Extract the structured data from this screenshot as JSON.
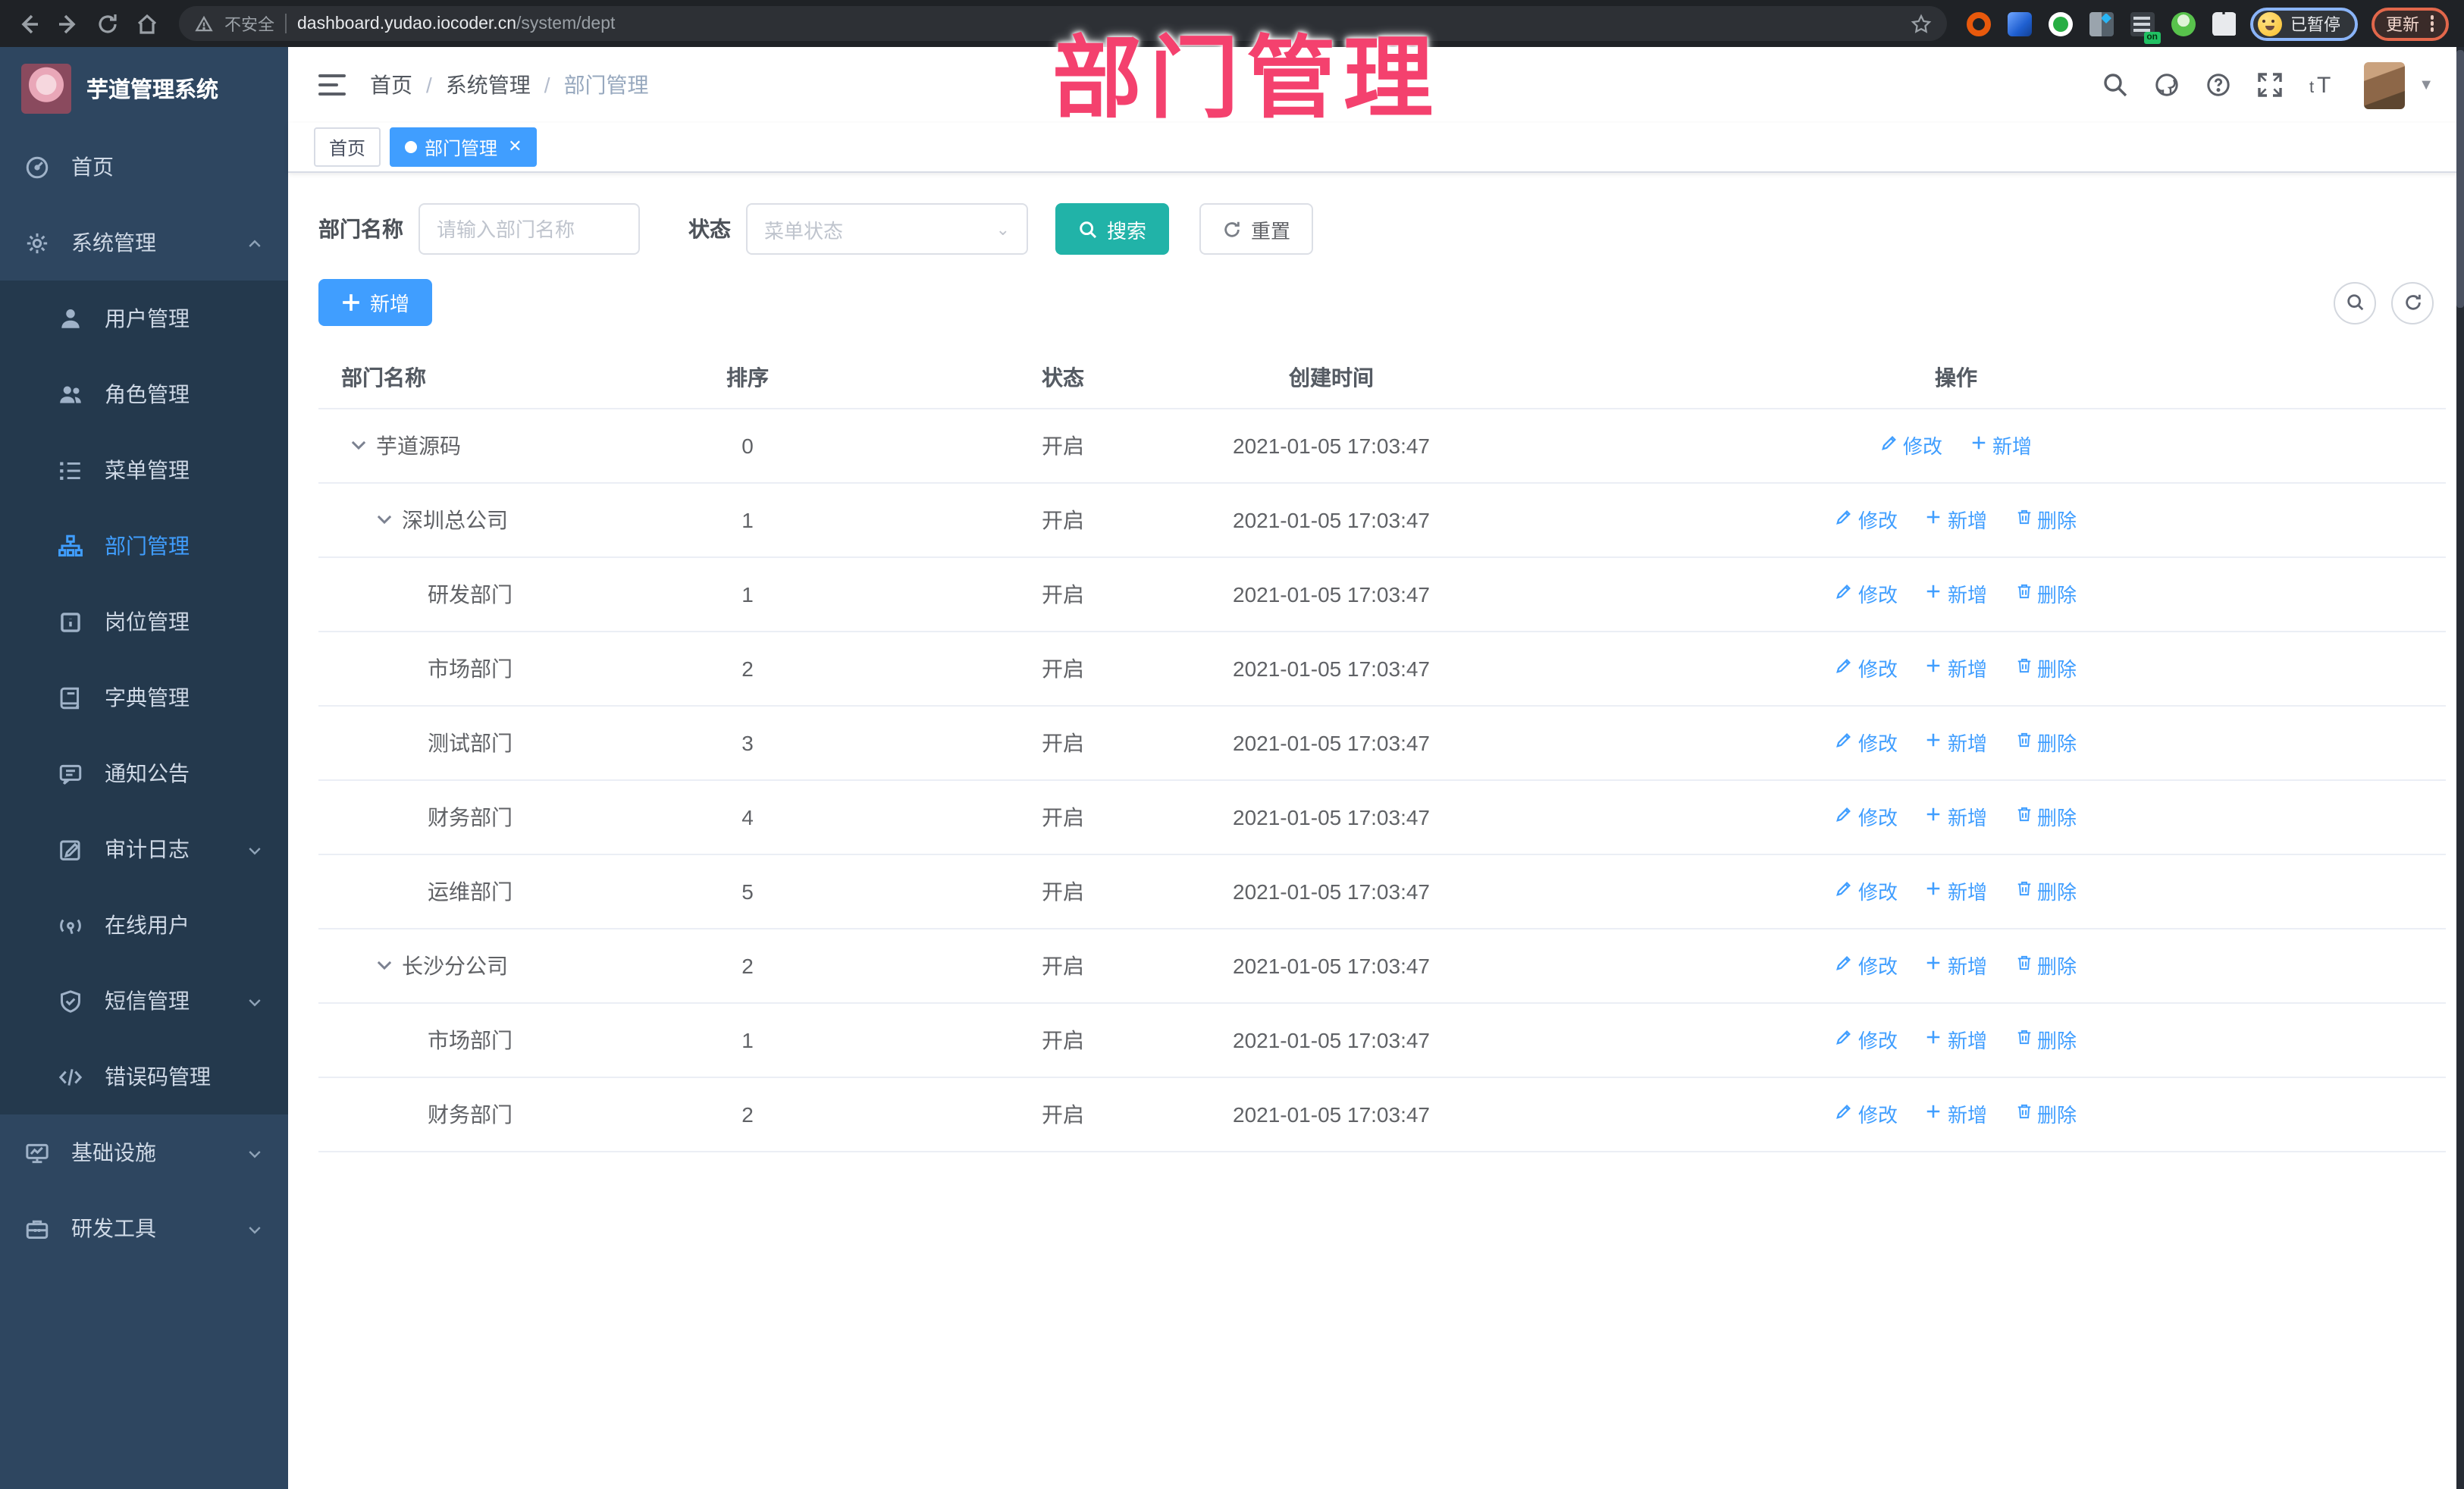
{
  "theme": {
    "accent_blue": "#409EFF",
    "search_teal": "#21b3a8",
    "overlay_pink": "#f4416e",
    "sidebar_bg": "#2e4660",
    "submenu_bg": "#24394d",
    "browser_bg": "#1f2226"
  },
  "browser": {
    "security_label": "不安全",
    "url_host": "dashboard.yudao.iocoder.cn",
    "url_path": "/system/dept",
    "profile_status": "已暂停",
    "update_label": "更新",
    "extension_on_badge": "on"
  },
  "sidebar": {
    "app_title": "芋道管理系统",
    "items": [
      {
        "label": "首页",
        "icon": "dashboard-icon",
        "type": "top"
      },
      {
        "label": "系统管理",
        "icon": "gear-icon",
        "type": "top",
        "arrow": "up"
      },
      {
        "label": "用户管理",
        "icon": "user-icon",
        "type": "sub"
      },
      {
        "label": "角色管理",
        "icon": "users-icon",
        "type": "sub"
      },
      {
        "label": "菜单管理",
        "icon": "menu-list-icon",
        "type": "sub"
      },
      {
        "label": "部门管理",
        "icon": "org-tree-icon",
        "type": "sub",
        "active": true
      },
      {
        "label": "岗位管理",
        "icon": "badge-icon",
        "type": "sub"
      },
      {
        "label": "字典管理",
        "icon": "dictionary-icon",
        "type": "sub"
      },
      {
        "label": "通知公告",
        "icon": "announcement-icon",
        "type": "sub"
      },
      {
        "label": "审计日志",
        "icon": "audit-log-icon",
        "type": "sub",
        "arrow": "down"
      },
      {
        "label": "在线用户",
        "icon": "online-users-icon",
        "type": "sub"
      },
      {
        "label": "短信管理",
        "icon": "sms-icon",
        "type": "sub",
        "arrow": "down"
      },
      {
        "label": "错误码管理",
        "icon": "code-icon",
        "type": "sub"
      },
      {
        "label": "基础设施",
        "icon": "infrastructure-icon",
        "type": "top",
        "arrow": "down"
      },
      {
        "label": "研发工具",
        "icon": "toolbox-icon",
        "type": "top",
        "arrow": "down"
      }
    ]
  },
  "header": {
    "breadcrumb": [
      "首页",
      "系统管理",
      "部门管理"
    ]
  },
  "tabs": [
    {
      "label": "首页",
      "active": false
    },
    {
      "label": "部门管理",
      "active": true,
      "closable": true
    }
  ],
  "overlay_title": "部门管理",
  "filters": {
    "dept_name_label": "部门名称",
    "dept_name_placeholder": "请输入部门名称",
    "dept_name_value": "",
    "status_label": "状态",
    "status_placeholder": "菜单状态",
    "search_label": "搜索",
    "reset_label": "重置"
  },
  "toolbar": {
    "add_label": "新增"
  },
  "table": {
    "columns": [
      "部门名称",
      "排序",
      "状态",
      "创建时间",
      "操作"
    ],
    "action_labels": {
      "edit": "修改",
      "add": "新增",
      "delete": "删除"
    },
    "rows": [
      {
        "name": "芋道源码",
        "level": 0,
        "expandable": true,
        "sort": "0",
        "status": "开启",
        "created": "2021-01-05 17:03:47",
        "actions": [
          "edit",
          "add"
        ]
      },
      {
        "name": "深圳总公司",
        "level": 1,
        "expandable": true,
        "sort": "1",
        "status": "开启",
        "created": "2021-01-05 17:03:47",
        "actions": [
          "edit",
          "add",
          "delete"
        ]
      },
      {
        "name": "研发部门",
        "level": 2,
        "expandable": false,
        "sort": "1",
        "status": "开启",
        "created": "2021-01-05 17:03:47",
        "actions": [
          "edit",
          "add",
          "delete"
        ]
      },
      {
        "name": "市场部门",
        "level": 2,
        "expandable": false,
        "sort": "2",
        "status": "开启",
        "created": "2021-01-05 17:03:47",
        "actions": [
          "edit",
          "add",
          "delete"
        ]
      },
      {
        "name": "测试部门",
        "level": 2,
        "expandable": false,
        "sort": "3",
        "status": "开启",
        "created": "2021-01-05 17:03:47",
        "actions": [
          "edit",
          "add",
          "delete"
        ]
      },
      {
        "name": "财务部门",
        "level": 2,
        "expandable": false,
        "sort": "4",
        "status": "开启",
        "created": "2021-01-05 17:03:47",
        "actions": [
          "edit",
          "add",
          "delete"
        ]
      },
      {
        "name": "运维部门",
        "level": 2,
        "expandable": false,
        "sort": "5",
        "status": "开启",
        "created": "2021-01-05 17:03:47",
        "actions": [
          "edit",
          "add",
          "delete"
        ]
      },
      {
        "name": "长沙分公司",
        "level": 1,
        "expandable": true,
        "sort": "2",
        "status": "开启",
        "created": "2021-01-05 17:03:47",
        "actions": [
          "edit",
          "add",
          "delete"
        ]
      },
      {
        "name": "市场部门",
        "level": 2,
        "expandable": false,
        "sort": "1",
        "status": "开启",
        "created": "2021-01-05 17:03:47",
        "actions": [
          "edit",
          "add",
          "delete"
        ]
      },
      {
        "name": "财务部门",
        "level": 2,
        "expandable": false,
        "sort": "2",
        "status": "开启",
        "created": "2021-01-05 17:03:47",
        "actions": [
          "edit",
          "add",
          "delete"
        ]
      }
    ]
  }
}
